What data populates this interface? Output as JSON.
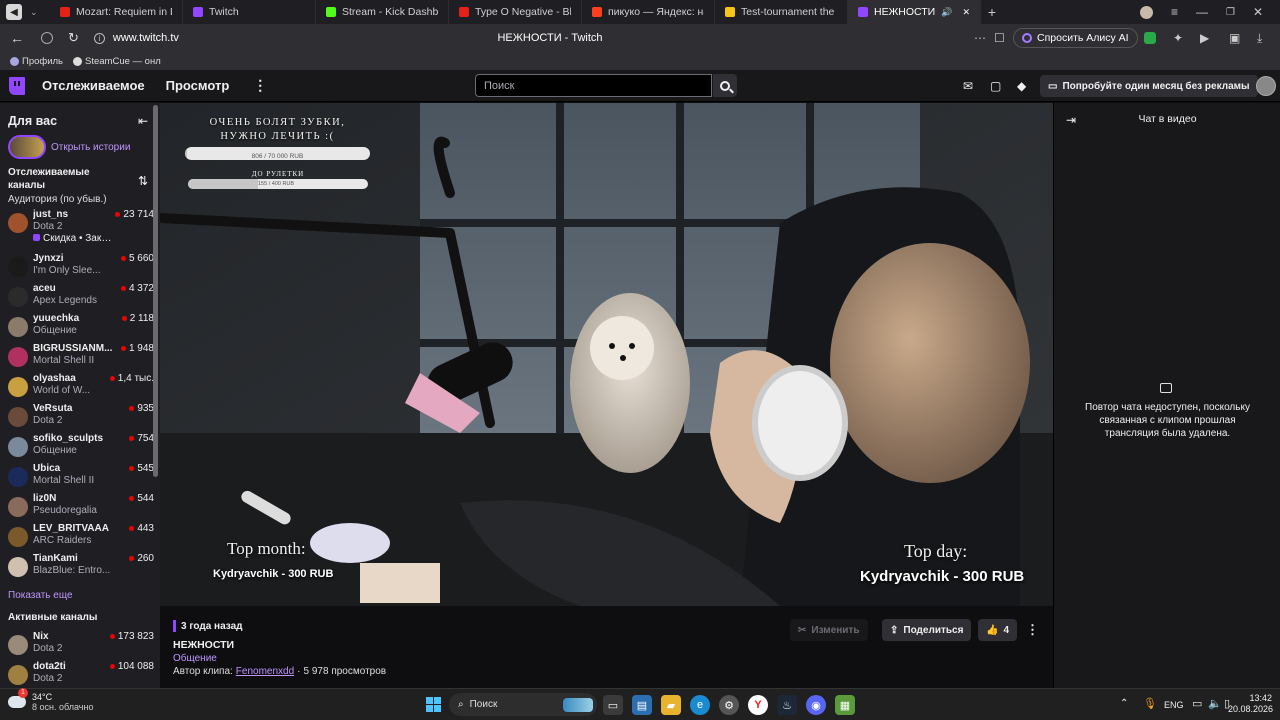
{
  "browser": {
    "tabs": [
      {
        "label": "Mozart: Requiem in D Min",
        "color": "#e62117",
        "audio": false
      },
      {
        "label": "Twitch",
        "color": "#9146ff",
        "audio": false
      },
      {
        "label": "Stream - Kick Dashboard",
        "color": "#53fc18",
        "audio": false
      },
      {
        "label": "Type O Negative - Black N",
        "color": "#e62117",
        "audio": false
      },
      {
        "label": "пикуко — Яндекс: нашлос",
        "color": "#fc3f1d",
        "audio": false
      },
      {
        "label": "Test-tournament the most",
        "color": "#f5c518",
        "audio": false
      },
      {
        "label": "НЕЖНОСТИ - Twitc",
        "color": "#9146ff",
        "audio": true
      }
    ],
    "url": "www.twitch.tv",
    "page_title": "НЕЖНОСТИ - Twitch",
    "alice_label": "Спросить Алису AI",
    "bookmarks": [
      {
        "label": "Профиль"
      },
      {
        "label": "SteamCue — онл"
      }
    ]
  },
  "twitch_header": {
    "following": "Отслеживаемое",
    "browse": "Просмотр",
    "search_placeholder": "Поиск",
    "promo": "Попробуйте один месяц без рекламы"
  },
  "sidebar": {
    "for_you": "Для вас",
    "open_stories": "Открыть истории",
    "followed_title": "Отслеживаемые каналы",
    "sort_label": "Аудитория (по убыв.)",
    "followed": [
      {
        "name": "just_ns",
        "game": "Dota 2",
        "viewers": "23 714",
        "extra": "Скидка • Заканчивае",
        "color": "#a0522d"
      },
      {
        "name": "Jynxzi",
        "game": "I'm Only Slee...",
        "viewers": "5 660",
        "color": "#1a1a1a"
      },
      {
        "name": "aceu",
        "game": "Apex Legends",
        "viewers": "4 372",
        "color": "#2b2b2b"
      },
      {
        "name": "yuuechka",
        "game": "Общение",
        "viewers": "2 118",
        "color": "#8b7b6b"
      },
      {
        "name": "BIGRUSSIANM...",
        "game": "Mortal Shell II",
        "viewers": "1 948",
        "color": "#b03060"
      },
      {
        "name": "olyashaa",
        "game": "World of W...",
        "viewers": "1,4 тыс.",
        "color": "#c8a040"
      },
      {
        "name": "VeRsuta",
        "game": "Dota 2",
        "viewers": "935",
        "color": "#6a4a3a"
      },
      {
        "name": "sofiko_sculpts",
        "game": "Общение",
        "viewers": "754",
        "color": "#7a8a9a"
      },
      {
        "name": "Ubica",
        "game": "Mortal Shell II",
        "viewers": "545",
        "color": "#1a2a5a"
      },
      {
        "name": "liz0N",
        "game": "Pseudoregalia",
        "viewers": "544",
        "color": "#8a6a5a"
      },
      {
        "name": "LEV_BRITVAAA",
        "game": "ARC Raiders",
        "viewers": "443",
        "color": "#7a5a2a"
      },
      {
        "name": "TianKami",
        "game": "BlazBlue: Entro...",
        "viewers": "260",
        "color": "#d0c0b0"
      }
    ],
    "show_more": "Показать еще",
    "active_title": "Активные каналы",
    "active": [
      {
        "name": "Nix",
        "game": "Dota 2",
        "viewers": "173 823",
        "color": "#9a8a7a"
      },
      {
        "name": "dota2ti",
        "game": "Dota 2",
        "viewers": "104 088",
        "color": "#a08040"
      }
    ]
  },
  "video": {
    "overlay_title": "ОЧЕНЬ БОЛЯТ ЗУБКИ, НУЖНО ЛЕЧИТЬ :(",
    "goal_value": "806 / 70 000 RUB",
    "goal_progress": 0.0115,
    "roulette_title": "ДО РУЛЕТКИ",
    "roulette_value": "155 / 400 RUB",
    "roulette_progress": 0.3875,
    "top_month_label": "Top month:",
    "top_month_value": "Kydryavchik - 300 RUB",
    "top_day_label": "Top day:",
    "top_day_value": "Kydryavchik - 300 RUB"
  },
  "clip_info": {
    "time_ago": "3 года назад",
    "title": "НЕЖНОСТИ",
    "category": "Общение",
    "author_prefix": "Автор клипа:",
    "author": "Fenomenxdd",
    "views": "5 978 просмотров",
    "edit": "Изменить",
    "share": "Поделиться",
    "likes": "4"
  },
  "chat": {
    "title": "Чат в видео",
    "unavailable": "Повтор чата недоступен, поскольку связанная с клипом прошлая трансляция была удалена."
  },
  "taskbar": {
    "weather_temp": "34°C",
    "weather_desc": "8 осн. облачно",
    "search": "Поиск",
    "lang": "ENG",
    "time": "13:42",
    "date": "20.08.2026"
  }
}
